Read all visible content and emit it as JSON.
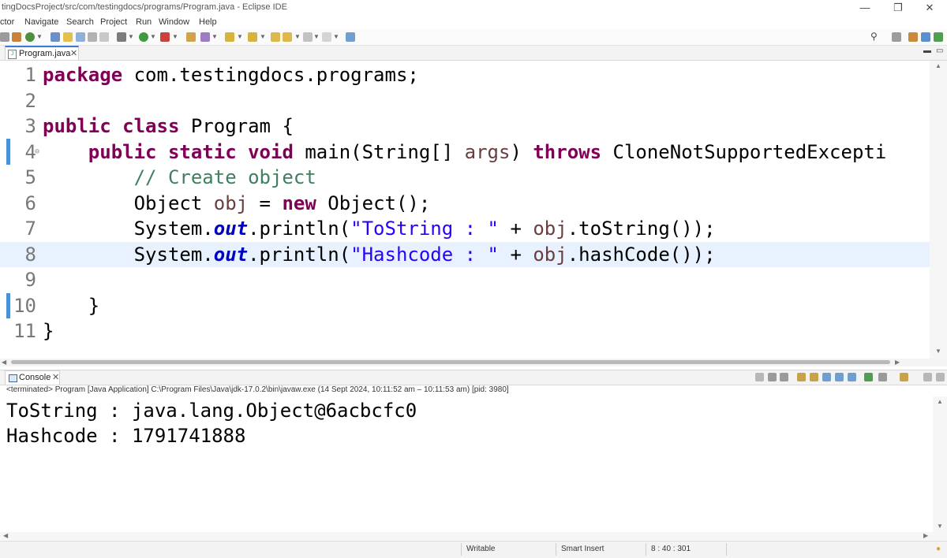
{
  "window": {
    "title": "tingDocsProject/src/com/testingdocs/programs/Program.java - Eclipse IDE",
    "minimize": "—",
    "maximize": "❐",
    "close": "✕"
  },
  "menu": [
    "ctor",
    "Navigate",
    "Search",
    "Project",
    "Run",
    "Window",
    "Help"
  ],
  "toolbar": {
    "search_icon": "search-icon",
    "accent": "#3a7ad9"
  },
  "editor_tab": {
    "label": "Program.java",
    "close": "✕",
    "minimize": "▬",
    "maximize": "▭"
  },
  "editor": {
    "lines": [
      {
        "num": "1",
        "segments": [
          {
            "t": "package",
            "c": "kw"
          },
          {
            "t": " com.testingdocs.programs;",
            "c": ""
          }
        ]
      },
      {
        "num": "2",
        "segments": []
      },
      {
        "num": "3",
        "segments": [
          {
            "t": "public",
            "c": "kw"
          },
          {
            "t": " ",
            "c": ""
          },
          {
            "t": "class",
            "c": "kw"
          },
          {
            "t": " Program {",
            "c": ""
          }
        ]
      },
      {
        "num": "4",
        "fold": "⊖",
        "segments": [
          {
            "t": "    ",
            "c": ""
          },
          {
            "t": "public",
            "c": "kw"
          },
          {
            "t": " ",
            "c": ""
          },
          {
            "t": "static",
            "c": "kw"
          },
          {
            "t": " ",
            "c": ""
          },
          {
            "t": "void",
            "c": "kw"
          },
          {
            "t": " main(String[] ",
            "c": ""
          },
          {
            "t": "args",
            "c": "var"
          },
          {
            "t": ") ",
            "c": ""
          },
          {
            "t": "throws",
            "c": "kw"
          },
          {
            "t": " CloneNotSupportedExcepti",
            "c": ""
          }
        ]
      },
      {
        "num": "5",
        "segments": [
          {
            "t": "        ",
            "c": ""
          },
          {
            "t": "// Create object",
            "c": "cm"
          }
        ]
      },
      {
        "num": "6",
        "segments": [
          {
            "t": "        Object ",
            "c": ""
          },
          {
            "t": "obj",
            "c": "var"
          },
          {
            "t": " = ",
            "c": ""
          },
          {
            "t": "new",
            "c": "kw"
          },
          {
            "t": " Object();",
            "c": ""
          }
        ]
      },
      {
        "num": "7",
        "segments": [
          {
            "t": "        System.",
            "c": ""
          },
          {
            "t": "out",
            "c": "fld"
          },
          {
            "t": ".println(",
            "c": ""
          },
          {
            "t": "\"ToString : \"",
            "c": "st"
          },
          {
            "t": " + ",
            "c": ""
          },
          {
            "t": "obj",
            "c": "var"
          },
          {
            "t": ".toString());",
            "c": ""
          }
        ]
      },
      {
        "num": "8",
        "current": true,
        "segments": [
          {
            "t": "        System.",
            "c": ""
          },
          {
            "t": "out",
            "c": "fld"
          },
          {
            "t": ".println(",
            "c": ""
          },
          {
            "t": "\"Hashcode : \"",
            "c": "st"
          },
          {
            "t": " + ",
            "c": ""
          },
          {
            "t": "obj",
            "c": "var"
          },
          {
            "t": ".hashCode());",
            "c": ""
          }
        ]
      },
      {
        "num": "9",
        "segments": []
      },
      {
        "num": "10",
        "segments": [
          {
            "t": "    }",
            "c": ""
          }
        ]
      },
      {
        "num": "11",
        "segments": [
          {
            "t": "}",
            "c": ""
          }
        ]
      }
    ]
  },
  "console": {
    "tab_label": "Console",
    "tab_close": "✕",
    "status": "<terminated> Program [Java Application] C:\\Program Files\\Java\\jdk-17.0.2\\bin\\javaw.exe  (14 Sept 2024, 10:11:52 am – 10:11:53 am) [pid: 3980]",
    "output": [
      "ToString : java.lang.Object@6acbcfc0",
      "Hashcode : 1791741888"
    ]
  },
  "statusbar": {
    "mode": "Writable",
    "insert": "Smart Insert",
    "position": "8 : 40 : 301"
  }
}
